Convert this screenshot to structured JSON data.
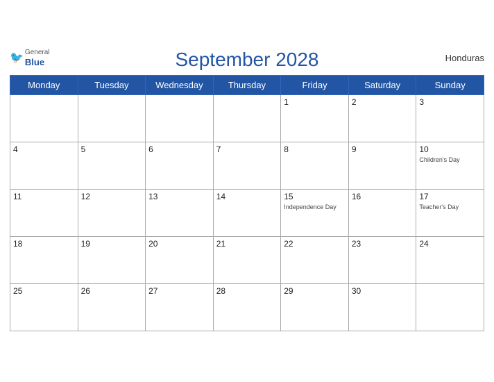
{
  "header": {
    "logo_general": "General",
    "logo_blue": "Blue",
    "title": "September 2028",
    "country": "Honduras"
  },
  "weekdays": [
    "Monday",
    "Tuesday",
    "Wednesday",
    "Thursday",
    "Friday",
    "Saturday",
    "Sunday"
  ],
  "weeks": [
    [
      {
        "day": "",
        "empty": true
      },
      {
        "day": "",
        "empty": true
      },
      {
        "day": "",
        "empty": true
      },
      {
        "day": "",
        "empty": true
      },
      {
        "day": "1"
      },
      {
        "day": "2"
      },
      {
        "day": "3"
      }
    ],
    [
      {
        "day": "4"
      },
      {
        "day": "5"
      },
      {
        "day": "6"
      },
      {
        "day": "7"
      },
      {
        "day": "8"
      },
      {
        "day": "9"
      },
      {
        "day": "10",
        "event": "Children's Day"
      }
    ],
    [
      {
        "day": "11"
      },
      {
        "day": "12"
      },
      {
        "day": "13"
      },
      {
        "day": "14"
      },
      {
        "day": "15",
        "event": "Independence Day"
      },
      {
        "day": "16"
      },
      {
        "day": "17",
        "event": "Teacher's Day"
      }
    ],
    [
      {
        "day": "18"
      },
      {
        "day": "19"
      },
      {
        "day": "20"
      },
      {
        "day": "21"
      },
      {
        "day": "22"
      },
      {
        "day": "23"
      },
      {
        "day": "24"
      }
    ],
    [
      {
        "day": "25"
      },
      {
        "day": "26"
      },
      {
        "day": "27"
      },
      {
        "day": "28"
      },
      {
        "day": "29"
      },
      {
        "day": "30"
      },
      {
        "day": "",
        "empty": true
      }
    ]
  ],
  "colors": {
    "header_bg": "#2255a4",
    "header_text": "#ffffff",
    "title_color": "#2255a4"
  }
}
